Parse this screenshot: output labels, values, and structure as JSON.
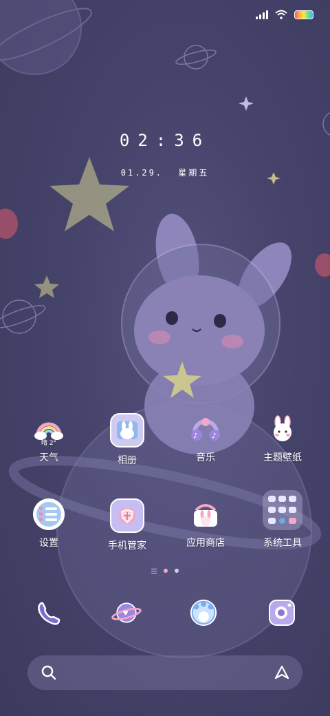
{
  "status_bar": {
    "signal_icon": "signal-icon",
    "wifi_icon": "wifi-icon",
    "battery_icon": "battery-icon"
  },
  "clock": {
    "time": "02:36",
    "date": "01.29.",
    "weekday": "星期五"
  },
  "apps": [
    {
      "label": "天气",
      "icon": "weather-rainbow-icon",
      "sub": "晴 2°"
    },
    {
      "label": "相册",
      "icon": "gallery-bunny-icon"
    },
    {
      "label": "音乐",
      "icon": "music-headphones-icon"
    },
    {
      "label": "主题壁纸",
      "icon": "themes-bunny-icon"
    },
    {
      "label": "设置",
      "icon": "settings-hearts-icon"
    },
    {
      "label": "手机管家",
      "icon": "security-shield-icon"
    },
    {
      "label": "应用商店",
      "icon": "app-store-bunny-icon"
    },
    {
      "label": "系统工具",
      "icon": "system-tools-folder-icon"
    }
  ],
  "dock": [
    {
      "icon": "phone-icon"
    },
    {
      "icon": "messages-planet-icon"
    },
    {
      "icon": "browser-bunny-icon"
    },
    {
      "icon": "camera-icon"
    }
  ],
  "search": {
    "search_icon": "search-icon",
    "assistant_icon": "assistant-icon"
  },
  "colors": {
    "background": "#45436a",
    "accent_pink": "#f4a7c5",
    "accent_lilac": "#b9a9ea"
  }
}
